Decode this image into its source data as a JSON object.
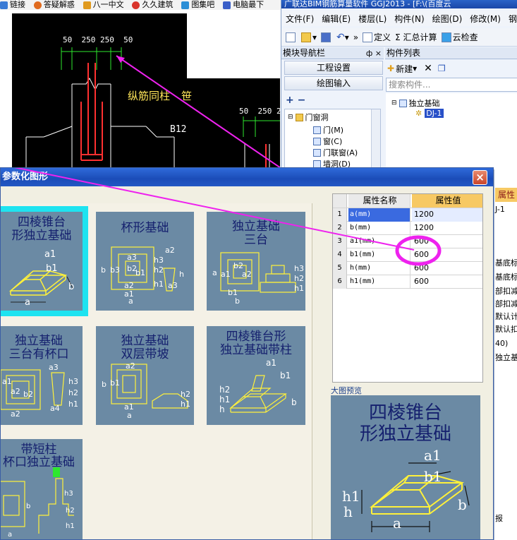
{
  "browser": {
    "bookmarks": [
      {
        "label": "链接",
        "color": "#3a7bd5"
      },
      {
        "label": "答疑解惑",
        "color": "#e06b1f"
      },
      {
        "label": "八一中文",
        "color": "#e09a1f"
      },
      {
        "label": "久久建筑",
        "color": "#d9342b"
      },
      {
        "label": "图集吧",
        "color": "#2d8fd6"
      },
      {
        "label": "电脑最下",
        "color": "#3a5fc8"
      }
    ]
  },
  "cad": {
    "dims_top": [
      "50",
      "250",
      "250",
      "50"
    ],
    "dims_right": [
      "50",
      "250",
      "2"
    ],
    "label_rebar": "纵筋同柱",
    "label_rebar_tail": "笹",
    "label_b12": "B12"
  },
  "app": {
    "title": "广联达BIM钢筋算量软件 GGJ2013 - [F:\\(百度云",
    "menu": [
      "文件(F)",
      "编辑(E)",
      "楼层(L)",
      "构件(N)",
      "绘图(D)",
      "修改(M)",
      "钢筋"
    ],
    "toolbar": [
      "»",
      "定义",
      "Σ 汇总计算",
      "云检查"
    ],
    "nav_title": "模块导航栏",
    "nav_pin": "ф ×",
    "nav_buttons": [
      "工程设置",
      "绘图输入"
    ],
    "nav_tools": "+ −",
    "tree": [
      "门窗洞",
      "门(M)",
      "窗(C)",
      "门联窗(A)",
      "墙洞(D)"
    ],
    "comp_title": "构件列表",
    "comp_new": "新建",
    "comp_search_placeholder": "搜索构件...",
    "comp_tree": [
      "独立基础",
      "DJ-1"
    ]
  },
  "dialog": {
    "title": "参数化图形",
    "close": "×",
    "tiles": [
      {
        "lines": [
          "四棱锥台",
          "形独立基础"
        ],
        "labels": [
          "a1",
          "b1",
          "b",
          "a"
        ]
      },
      {
        "lines": [
          "杯形基础"
        ],
        "labels": [
          "a2",
          "b3",
          "b2",
          "b1",
          "b",
          "a3",
          "a2",
          "a1",
          "a",
          "h3",
          "h2",
          "h1",
          "h",
          "a3"
        ]
      },
      {
        "lines": [
          "独立基础",
          "三台"
        ],
        "labels": [
          "a",
          "b2",
          "a2",
          "b1",
          "a1",
          "b",
          "h3",
          "h2",
          "h1"
        ]
      },
      {
        "lines": [
          "独立基础",
          "三台有杯口"
        ],
        "labels": [
          "a3",
          "a1",
          "a2",
          "b2",
          "a2",
          "a4",
          "h3",
          "h2",
          "h1"
        ]
      },
      {
        "lines": [
          "独立基础",
          "双层带坡"
        ],
        "labels": [
          "a2",
          "b1",
          "b",
          "a1",
          "a",
          "h2",
          "h1"
        ]
      },
      {
        "lines": [
          "四棱锥台形",
          "独立基础带柱"
        ],
        "labels": [
          "a1",
          "b1",
          "h2",
          "h1",
          "h",
          "b"
        ]
      },
      {
        "lines": [
          "带短柱",
          "杯口独立基础"
        ],
        "labels": [
          "h3",
          "h2",
          "h1",
          "b",
          "a"
        ]
      }
    ],
    "properties": {
      "header_name": "属性名称",
      "header_value": "属性值",
      "rows": [
        {
          "n": "1",
          "name": "a(mm)",
          "value": "1200"
        },
        {
          "n": "2",
          "name": "b(mm)",
          "value": "1200"
        },
        {
          "n": "3",
          "name": "a1(mm)",
          "value": "600"
        },
        {
          "n": "4",
          "name": "b1(mm)",
          "value": "600"
        },
        {
          "n": "5",
          "name": "h(mm)",
          "value": "600"
        },
        {
          "n": "6",
          "name": "h1(mm)",
          "value": "600"
        }
      ]
    },
    "preview_label": "大图预览",
    "preview": {
      "lines": [
        "四棱锥台",
        "形独立基础"
      ],
      "labels": [
        "a1",
        "b1",
        "h1",
        "h",
        "b",
        "a"
      ]
    }
  },
  "right_strip": [
    "属性",
    "J-1",
    "基底标高",
    "基底标高",
    "部扣减",
    "部扣减",
    "默认计",
    "默认扣",
    "40)",
    "独立基",
    "报"
  ],
  "colors": {
    "accent": "#1ee3f0",
    "annotation": "#ee22ee",
    "tile": "#6b8aa4",
    "value_header": "#f7c964"
  }
}
